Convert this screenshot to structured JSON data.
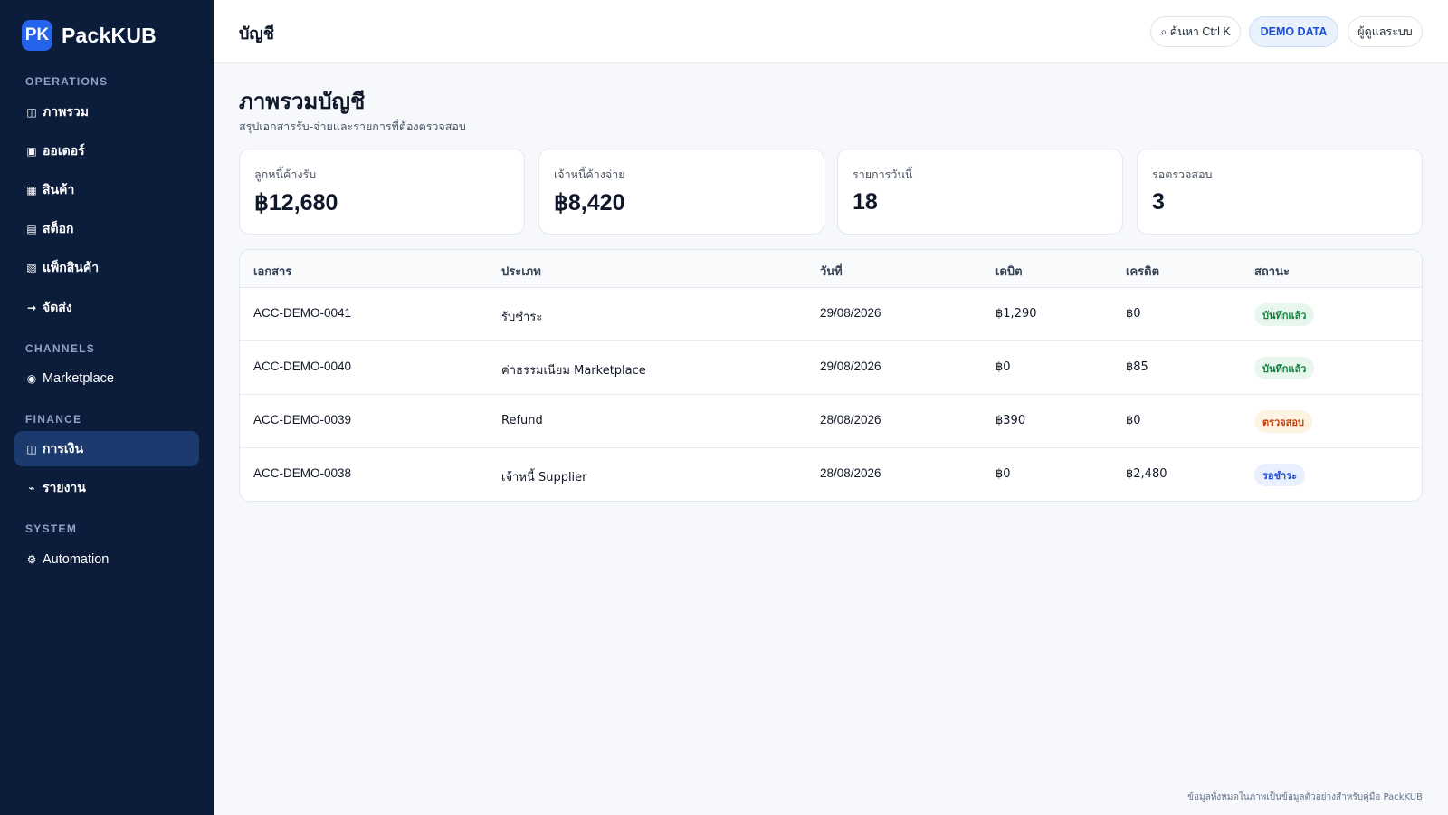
{
  "app": {
    "logo": "PK",
    "name": "PackKUB"
  },
  "sidebar": {
    "sections": [
      {
        "label": "OPERATIONS",
        "items": [
          {
            "icon": "◫",
            "label": "ภาพรวม"
          },
          {
            "icon": "▣",
            "label": "ออเดอร์"
          },
          {
            "icon": "▦",
            "label": "สินค้า"
          },
          {
            "icon": "▤",
            "label": "สต็อก"
          },
          {
            "icon": "▧",
            "label": "แพ็กสินค้า"
          },
          {
            "icon": "→",
            "label": "จัดส่ง"
          }
        ]
      },
      {
        "label": "CHANNELS",
        "items": [
          {
            "icon": "◉",
            "label": "Marketplace"
          }
        ]
      },
      {
        "label": "FINANCE",
        "items": [
          {
            "icon": "◫",
            "label": "การเงิน",
            "active": true
          },
          {
            "icon": "⌁",
            "label": "รายงาน"
          }
        ]
      },
      {
        "label": "SYSTEM",
        "items": [
          {
            "icon": "⚙",
            "label": "Automation"
          }
        ]
      }
    ]
  },
  "topbar": {
    "title": "บัญชี",
    "search_label": "⌕ ค้นหา Ctrl K",
    "demo_label": "DEMO DATA",
    "user_label": "ผู้ดูแลระบบ"
  },
  "main": {
    "title": "ภาพรวมบัญชี",
    "subtitle": "สรุปเอกสารรับ-จ่ายและรายการที่ต้องตรวจสอบ",
    "stats": [
      {
        "label": "ลูกหนี้ค้างรับ",
        "value": "฿12,680"
      },
      {
        "label": "เจ้าหนี้ค้างจ่าย",
        "value": "฿8,420"
      },
      {
        "label": "รายการวันนี้",
        "value": "18"
      },
      {
        "label": "รอตรวจสอบ",
        "value": "3"
      }
    ],
    "table": {
      "headers": [
        "เอกสาร",
        "ประเภท",
        "วันที่",
        "เดบิต",
        "เครดิต",
        "สถานะ"
      ],
      "rows": [
        {
          "doc": "ACC-DEMO-0041",
          "type": "รับชำระ",
          "date": "29/08/2026",
          "debit": "฿1,290",
          "credit": "฿0",
          "status": "บันทึกแล้ว",
          "status_kind": "success"
        },
        {
          "doc": "ACC-DEMO-0040",
          "type": "ค่าธรรมเนียม Marketplace",
          "date": "29/08/2026",
          "debit": "฿0",
          "credit": "฿85",
          "status": "บันทึกแล้ว",
          "status_kind": "success"
        },
        {
          "doc": "ACC-DEMO-0039",
          "type": "Refund",
          "date": "28/08/2026",
          "debit": "฿390",
          "credit": "฿0",
          "status": "ตรวจสอบ",
          "status_kind": "warning"
        },
        {
          "doc": "ACC-DEMO-0038",
          "type": "เจ้าหนี้ Supplier",
          "date": "28/08/2026",
          "debit": "฿0",
          "credit": "฿2,480",
          "status": "รอชำระ",
          "status_kind": "info"
        }
      ]
    }
  },
  "footer": {
    "note": "ข้อมูลทั้งหมดในภาพเป็นข้อมูลตัวอย่างสำหรับคู่มือ PackKUB"
  },
  "colors": {
    "sidebar_bg": "#0c1d3b",
    "sidebar_active": "#1b3b6e",
    "accent": "#2563eb",
    "success_bg": "#e7f7ee",
    "success_fg": "#15803d",
    "warning_bg": "#fdf3e2",
    "warning_fg": "#c2410c",
    "info_bg": "#e8efff",
    "info_fg": "#1d4ed8"
  }
}
